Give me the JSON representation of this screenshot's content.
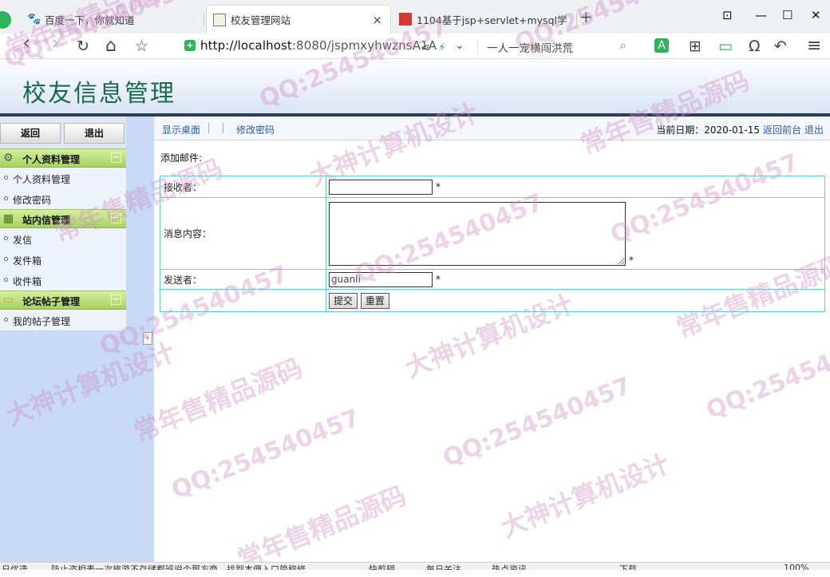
{
  "browser": {
    "tabs": [
      {
        "title": "百度一下，你就知道",
        "favicon": "baidu-paw-icon",
        "active": false
      },
      {
        "title": "校友管理网站",
        "favicon": "page-icon",
        "active": true
      },
      {
        "title": "1104基于jsp+servlet+mysql学",
        "favicon": "red-site-icon",
        "active": false
      }
    ],
    "close_glyph": "×",
    "new_tab_glyph": "+",
    "window_controls": [
      "⊡",
      "—",
      "☐",
      "✕"
    ],
    "address_host": "http://localhost",
    "address_rest": ":8080/jspmxyhwznsA1A",
    "search_text": "一人一宠横闯洪荒",
    "nav_glyphs": {
      "back": "‹",
      "forward": "›",
      "reload": "↻",
      "home": "⌂",
      "star": "☆",
      "share": "⋖",
      "bolt": "⚡",
      "chevron": "⌄",
      "search": "⌕",
      "translate": "A",
      "apps": "⊞",
      "battery": "▭",
      "headphones": "Ω",
      "undo": "↶",
      "menu": "≡"
    }
  },
  "site": {
    "title": "校友信息管理"
  },
  "sidebar": {
    "back_label": "返回",
    "exit_label": "退出",
    "collapse_glyph": "‹",
    "min_glyph": "−",
    "groups": [
      {
        "title": "个人资料管理",
        "icon": "gear-icon",
        "glyph": "⚙",
        "items": [
          "个人资料管理",
          "修改密码"
        ]
      },
      {
        "title": "站内信管理",
        "icon": "calendar-icon",
        "glyph": "▦",
        "items": [
          "发信",
          "发件箱",
          "收件箱"
        ]
      },
      {
        "title": "论坛帖子管理",
        "icon": "folder-icon",
        "glyph": "▭",
        "items": [
          "我的帖子管理"
        ]
      }
    ]
  },
  "topnav": {
    "home_link": "显示桌面",
    "pwd_link": "修改密码",
    "date_text": "当前日期：2020-01-15",
    "back_front": "返回前台",
    "exit": "退出"
  },
  "form": {
    "heading": "添加邮件:",
    "receiver_label": "接收者：",
    "receiver_value": "",
    "content_label": "消息内容：",
    "content_value": "",
    "sender_label": "发送者：",
    "sender_value": "guanli",
    "required_mark": "*",
    "submit_label": "提交",
    "reset_label": "重置"
  },
  "watermark": {
    "qq": "QQ:254540457",
    "line1": "常年售精品源码",
    "line2": "大神计算机设计"
  },
  "statusbar": {
    "items": [
      "日优选",
      "防止盗相表一次旅游不存储都班说个那方商。找到本便入口简称修",
      "快剪辑",
      "每日关注",
      "热点资讯",
      "下载",
      "100%"
    ]
  },
  "colors": {
    "title_green": "#1a6a4f",
    "sidebar_head_green": "#a6d35f",
    "table_border": "#5bd2d6",
    "link_blue": "#2a5dab",
    "watermark": "#cd8cc3"
  }
}
